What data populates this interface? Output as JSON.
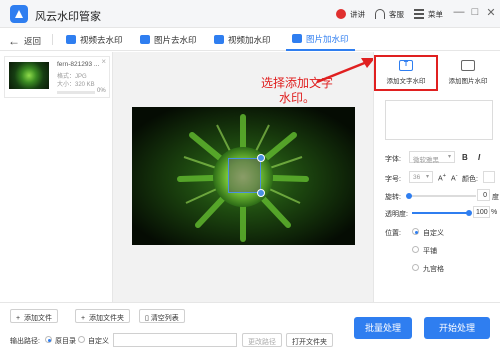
{
  "app": {
    "title": "风云水印管家"
  },
  "titlebar": {
    "vip": "讲讲",
    "support": "客服",
    "menu": "菜单",
    "minimize": "—",
    "maximize": "□",
    "close": "✕"
  },
  "toolbar": {
    "back": "返回",
    "tabs": [
      {
        "label": "视频去水印"
      },
      {
        "label": "图片去水印"
      },
      {
        "label": "视频加水印"
      },
      {
        "label": "图片加水印"
      }
    ]
  },
  "file": {
    "name": "fern-821293 ...",
    "format": "格式：JPG",
    "size": "大小：320 KB",
    "progress_pct": "0%",
    "progress_value": 0
  },
  "annotation": {
    "text": "选择添加文字水印。"
  },
  "panel": {
    "tab_text": "添加文字水印",
    "tab_image": "添加图片水印",
    "font_label": "字体:",
    "font_value": "微软雅黑",
    "bold": "B",
    "italic": "I",
    "size_label": "字号:",
    "size_value": "36",
    "size_up": "A",
    "size_down": "A",
    "color_label": "颜色:",
    "rotate_label": "旋转:",
    "rotate_value": "0",
    "rotate_unit": "度",
    "opacity_label": "透明度:",
    "opacity_value": "100",
    "opacity_unit": "%",
    "position_label": "位置:",
    "position_options": [
      "自定义",
      "平铺",
      "九宫格"
    ]
  },
  "bottom": {
    "add_file": "添加文件",
    "add_folder": "添加文件夹",
    "clear_list": "清空列表",
    "output_label": "输出路径:",
    "original_dir": "原目录",
    "custom": "自定义",
    "change_path": "更改路径",
    "open_folder": "打开文件夹",
    "batch": "批量处理",
    "start": "开始处理"
  },
  "colors": {
    "accent": "#2f7ef0",
    "annotation": "#e02020"
  }
}
